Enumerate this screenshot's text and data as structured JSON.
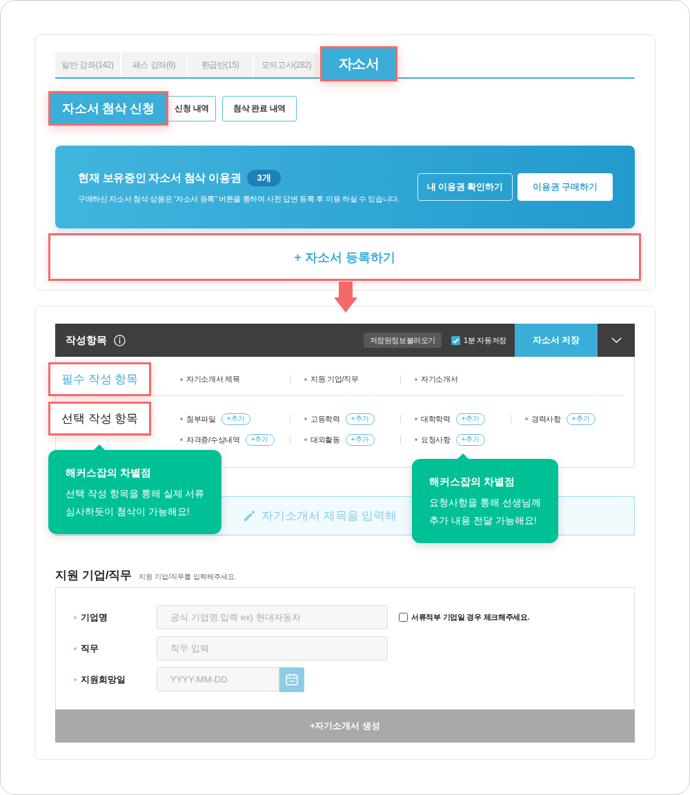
{
  "tabs": [
    {
      "label": "일반 강좌(142)",
      "selected": false,
      "highlighted": false
    },
    {
      "label": "패스 강좌(6)",
      "selected": false,
      "highlighted": false
    },
    {
      "label": "환급반(15)",
      "selected": false,
      "highlighted": false
    },
    {
      "label": "모의고사(282)",
      "selected": false,
      "highlighted": false
    },
    {
      "label": "자소서",
      "selected": true,
      "highlighted": true
    }
  ],
  "sub_tabs": [
    {
      "label": "자소서 첨삭 신청",
      "selected": true,
      "highlighted": true
    },
    {
      "label": "신청 내역",
      "selected": false,
      "highlighted": false
    },
    {
      "label": "첨삭 완료 내역",
      "selected": false,
      "highlighted": false
    }
  ],
  "voucher_banner": {
    "title": "현재 보유중인 자소서 첨삭 이용권",
    "count": "3개",
    "note": "구매하신 자소서 첨삭 상품은 “자소서 등록” 버튼을 통하여 사전 답변 등록 후 이용 하실 수 있습니다.",
    "buttons": [
      {
        "label": "내 이용권 확인하기",
        "kind": "outline"
      },
      {
        "label": "이용권 구매하기",
        "kind": "solid"
      }
    ]
  },
  "register_button": {
    "label": "+ 자소서 등록하기",
    "highlighted": true
  },
  "editor": {
    "title": "작성항목",
    "load_button": "저장된정보불러오기",
    "autosave": {
      "label": "1분 자동저장",
      "checked": true
    },
    "save_button": "자소서 저장"
  },
  "sections": [
    {
      "label": "필수 작성 항목",
      "kind": "required",
      "highlighted": true,
      "items": [
        {
          "label": "자기소개서 제목"
        },
        {
          "label": "지원 기업/직무"
        },
        {
          "label": "자기소개서"
        }
      ]
    },
    {
      "label": "선택 작성 항목",
      "kind": "optional",
      "highlighted": true,
      "callout": {
        "title": "해커스잡의 차별점",
        "text": "선택 작성 항목을 통해 실제 서류\n심사하듯이 첨삭이 가능해요!"
      },
      "items": [
        {
          "label": "첨부파일",
          "add": "+추가"
        },
        {
          "label": "고등학력",
          "add": "+추가"
        },
        {
          "label": "대학학력",
          "add": "+추가"
        },
        {
          "label": "경력사항",
          "add": "+추가"
        },
        {
          "label": "자격증/수상내역",
          "add": "+추가"
        },
        {
          "label": "대외활동",
          "add": "+추가"
        },
        {
          "label": "요청사항",
          "add": "+추가",
          "callout": {
            "title": "해커스잡의 차별점",
            "text": "요청사항을 통해 선생님께\n추가 내용 전달 가능해요!"
          }
        }
      ]
    }
  ],
  "title_field": {
    "placeholder": "자기소개서 제목을 입력해"
  },
  "company_form": {
    "title": "지원 기업/직무",
    "hint": "지원 기업/직무를 입력해주세요.",
    "fields": [
      {
        "label": "기업명",
        "kind": "text",
        "placeholder": "공식 기업명 입력 ex) 현대자동차",
        "checkbox": {
          "label": "서류적부 기업일 경우 체크해주세요.",
          "checked": false
        }
      },
      {
        "label": "직무",
        "kind": "text",
        "placeholder": "직무 입력"
      },
      {
        "label": "지원희망일",
        "kind": "date",
        "placeholder": "YYYY-MM-DD"
      }
    ],
    "submit": "+자기소개서 생성"
  }
}
